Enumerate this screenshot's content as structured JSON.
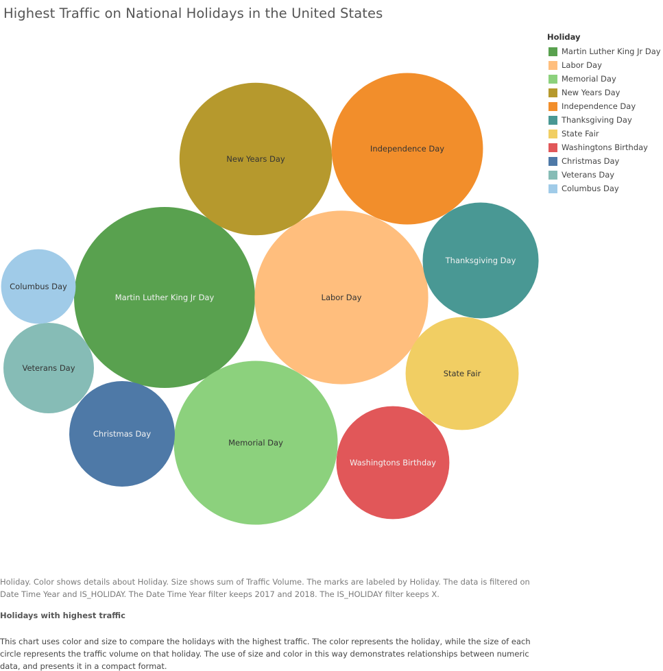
{
  "title": "Highest Traffic on National Holidays in the United States",
  "legend": {
    "title": "Holiday",
    "items": [
      {
        "label": "Martin Luther King Jr Day",
        "color": "#59a14f"
      },
      {
        "label": "Labor Day",
        "color": "#ffbe7d"
      },
      {
        "label": "Memorial Day",
        "color": "#8cd17d"
      },
      {
        "label": "New Years Day",
        "color": "#b6992d"
      },
      {
        "label": "Independence Day",
        "color": "#f28e2b"
      },
      {
        "label": "Thanksgiving Day",
        "color": "#499894"
      },
      {
        "label": "State Fair",
        "color": "#f1ce63"
      },
      {
        "label": "Washingtons Birthday",
        "color": "#e15759"
      },
      {
        "label": "Christmas Day",
        "color": "#4e79a7"
      },
      {
        "label": "Veterans Day",
        "color": "#86bcb6"
      },
      {
        "label": "Columbus Day",
        "color": "#a0cbe8"
      }
    ]
  },
  "chart_data": {
    "type": "bubble",
    "size_measure": "Traffic Volume",
    "color_dimension": "Holiday",
    "series": [
      {
        "name": "Martin Luther King Jr Day",
        "relative_size": 1.0,
        "label_color": "light"
      },
      {
        "name": "Labor Day",
        "relative_size": 0.92,
        "label_color": "dark"
      },
      {
        "name": "Memorial Day",
        "relative_size": 0.82,
        "label_color": "dark"
      },
      {
        "name": "New Years Day",
        "relative_size": 0.71,
        "label_color": "dark"
      },
      {
        "name": "Independence Day",
        "relative_size": 0.7,
        "label_color": "dark"
      },
      {
        "name": "Thanksgiving Day",
        "relative_size": 0.41,
        "label_color": "light"
      },
      {
        "name": "State Fair",
        "relative_size": 0.39,
        "label_color": "dark"
      },
      {
        "name": "Washingtons Birthday",
        "relative_size": 0.39,
        "label_color": "light"
      },
      {
        "name": "Christmas Day",
        "relative_size": 0.34,
        "label_color": "light"
      },
      {
        "name": "Veterans Day",
        "relative_size": 0.25,
        "label_color": "dark"
      },
      {
        "name": "Columbus Day",
        "relative_size": 0.17,
        "label_color": "dark"
      }
    ]
  },
  "caption": "Holiday. Color shows details about Holiday. Size shows sum of Traffic Volume. The marks are labeled by Holiday. The data is filtered on Date Time Year and IS_HOLIDAY. The Date Time Year filter keeps 2017 and 2018. The IS_HOLIDAY filter keeps X.",
  "subheading": "Holidays with highest traffic",
  "description": "This chart uses color and size to compare the holidays with the highest traffic. The color represents the holiday, while the size of each circle represents the traffic volume on that holiday. The use of size and color in this way demonstrates relationships between numeric data, and presents it in a compact format."
}
